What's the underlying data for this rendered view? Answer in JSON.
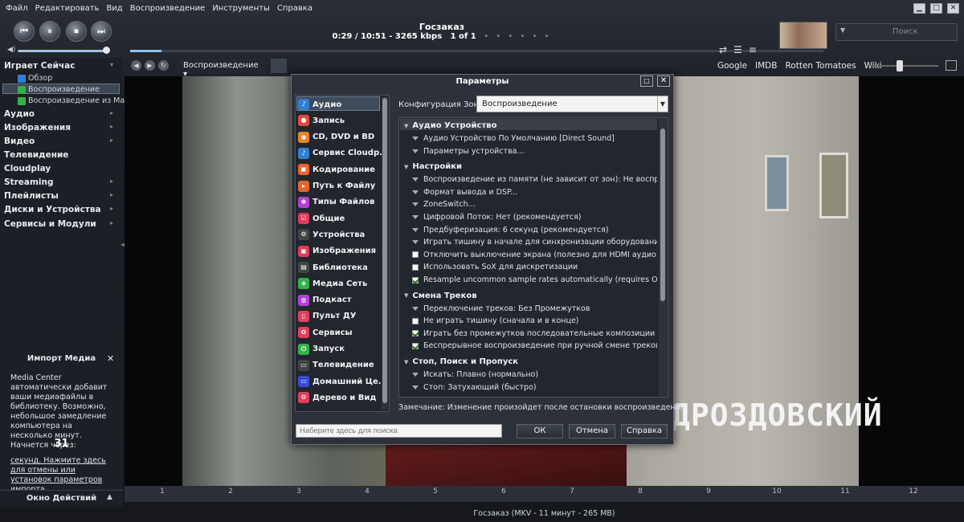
{
  "menu": [
    "Файл",
    "Редактировать",
    "Вид",
    "Воспроизведение",
    "Инструменты",
    "Справка"
  ],
  "window_buttons": [
    "▁",
    "□",
    "✕"
  ],
  "player": {
    "title": "Госзаказ",
    "info": "0:29 / 10:51 - 3265 kbps",
    "track_pos": "1 of 1",
    "dots": "• • • • • •",
    "search_placeholder": "Поиск",
    "volume_level": 0.96,
    "seek_position": 0.045,
    "buttons": [
      "⏮",
      "⏸",
      "⏹",
      "⏭"
    ],
    "side_controls": [
      "⇄",
      "☰",
      "≡"
    ]
  },
  "toolbar": {
    "view_label": "Воспроизведение ▾",
    "links": [
      "Google",
      "IMDB",
      "Rotten Tomatoes",
      "Wiki"
    ],
    "nav_icons": [
      "back-icon",
      "forward-icon",
      "refresh-icon"
    ]
  },
  "sidebar": {
    "now_playing": "Играет Сейчас",
    "sub_items": [
      "Обзор",
      "Воспроизведение",
      "Воспроизведение из Ма..."
    ],
    "items": [
      "Аудио",
      "Изображения",
      "Видео",
      "Телевидение",
      "Cloudplay",
      "Streaming",
      "Плейлисты",
      "Диски и Устройства",
      "Сервисы и Модули"
    ],
    "import": {
      "title": "Импорт Медиа",
      "close": "✕",
      "text": "Media Center автоматически добавит ваши медиафайлы в библиотеку. Возможно, небольшое замедление компьютера на несколько минут. Начнется через:",
      "countdown": "31",
      "link": "секунд. Нажмите здесь для отмены или установок параметров импорта."
    },
    "actions": "Окно Действий"
  },
  "video": {
    "caption": "ДРОЗДОВСКИЙ"
  },
  "timeline": {
    "ticks": [
      "1",
      "2",
      "3",
      "4",
      "5",
      "6",
      "7",
      "8",
      "9",
      "10",
      "11",
      "12"
    ]
  },
  "status": "Госзаказ (MKV - 11 минут - 265 MB)",
  "dialog": {
    "title": "Параметры",
    "categories": [
      "Аудио",
      "Запись",
      "CD, DVD и BD",
      "Сервис Cloudp...",
      "Кодирование",
      "Путь к Файлу",
      "Типы Файлов",
      "Общие",
      "Устройства",
      "Изображения",
      "Библиотека",
      "Медиа Сеть",
      "Подкаст",
      "Пульт ДУ",
      "Сервисы",
      "Запуск",
      "Телевидение",
      "Домашний Це...",
      "Дерево и Вид"
    ],
    "category_colors": [
      "#2f7fd6",
      "#e04a3a",
      "#e8832a",
      "#2f7fd6",
      "#e8632a",
      "#e8632a",
      "#b23fd6",
      "#e03a5a",
      "#444",
      "#e03a5a",
      "#444",
      "#35b04a",
      "#b23fd6",
      "#e0405a",
      "#e0405a",
      "#35b04a",
      "#444",
      "#3a4ad6",
      "#e0405a"
    ],
    "zone_label": "Конфигурация Зоны:",
    "zone_value": "Воспроизведение",
    "groups": [
      {
        "name": "Аудио Устройство",
        "options": [
          {
            "type": "arrow",
            "text": "Аудио Устройство По Умолчанию [Direct Sound]"
          },
          {
            "type": "arrow",
            "text": "Параметры устройства..."
          }
        ]
      },
      {
        "name": "Настройки",
        "options": [
          {
            "type": "arrow",
            "text": "Воспроизведение из памяти (не зависит от зон): Не воспроизвод..."
          },
          {
            "type": "arrow",
            "text": "Формат вывода и DSP..."
          },
          {
            "type": "arrow",
            "text": "ZoneSwitch..."
          },
          {
            "type": "arrow",
            "text": "Цифровой Поток: Нет (рекомендуется)"
          },
          {
            "type": "arrow",
            "text": "Предбуферизация: 6 секунд (рекомендуется)"
          },
          {
            "type": "arrow",
            "text": "Играть тишину в начале для синхронизации оборудования: Нет"
          },
          {
            "type": "cb",
            "checked": false,
            "text": "Отключить выключение экрана (полезно для HDMI аудио)"
          },
          {
            "type": "cb",
            "checked": false,
            "text": "Использовать SoX для дискретизации"
          },
          {
            "type": "cb",
            "checked": true,
            "text": "Resample uncommon sample rates automatically (requires Output F..."
          }
        ]
      },
      {
        "name": "Смена Треков",
        "options": [
          {
            "type": "arrow",
            "text": "Переключение треков: Без Промежутков"
          },
          {
            "type": "cb",
            "checked": false,
            "text": "Не играть тишину (сначала и в конце)"
          },
          {
            "type": "cb",
            "checked": true,
            "text": "Играть без промежутков последовательные композиции альбома"
          },
          {
            "type": "cb",
            "checked": true,
            "text": "Беспрерывное воспроизведение при ручной смене треков"
          }
        ]
      },
      {
        "name": "Стоп, Поиск и Пропуск",
        "options": [
          {
            "type": "arrow",
            "text": "Искать: Плавно (нормально)"
          },
          {
            "type": "arrow",
            "text": "Стоп: Затухающий (быстро)"
          }
        ]
      }
    ],
    "note": "Замечание: Изменение произойдет после остановки воспроизведения",
    "search_placeholder": "Наберите здесь для поиска",
    "buttons": [
      "ОК",
      "Отмена",
      "Справка"
    ]
  }
}
